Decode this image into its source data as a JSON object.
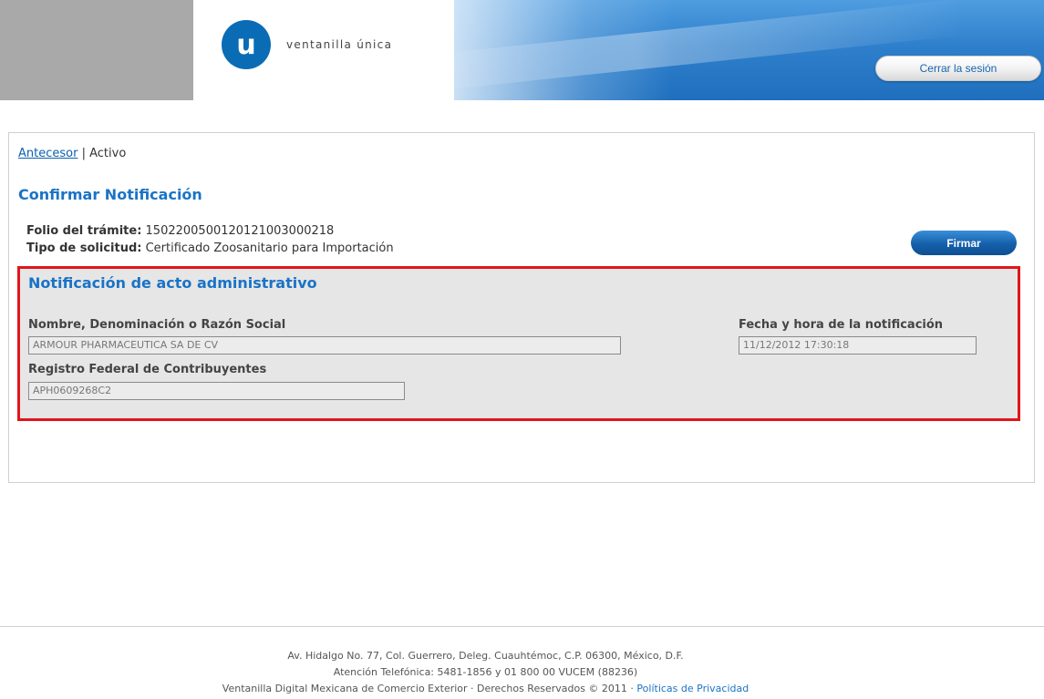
{
  "header": {
    "logo_letter": "u",
    "logo_text": "ventanilla única",
    "logout_label": "Cerrar la sesión"
  },
  "breadcrumb": {
    "link": "Antecesor",
    "separator": " | ",
    "current": "Activo"
  },
  "page_title": "Confirmar Notificación",
  "info": {
    "folio_label": "Folio del trámite:",
    "folio_value": "1502200500120121003000218",
    "tipo_label": "Tipo de solicitud:",
    "tipo_value": "Certificado Zoosanitario para Importación"
  },
  "sign_button": "Firmar",
  "notification": {
    "title": "Notificación de acto administrativo",
    "name_label": "Nombre, Denominación o Razón Social",
    "name_value": "ARMOUR PHARMACEUTICA SA DE CV",
    "date_label": "Fecha y hora de la notificación",
    "date_value": "11/12/2012 17:30:18",
    "rfc_label": "Registro Federal de Contribuyentes",
    "rfc_value": "APH0609268C2"
  },
  "footer": {
    "line1": "Av. Hidalgo No. 77, Col. Guerrero, Deleg. Cuauhtémoc, C.P. 06300, México, D.F.",
    "line2": "Atención Telefónica: 5481-1856 y 01 800 00 VUCEM (88236)",
    "line3": "Ventanilla Digital Mexicana de Comercio Exterior · Derechos Reservados © 2011 · ",
    "privacy_link": "Políticas de Privacidad"
  }
}
